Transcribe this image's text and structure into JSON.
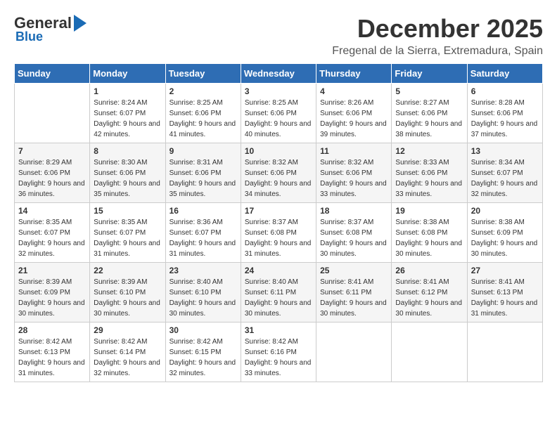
{
  "logo": {
    "general": "General",
    "blue": "Blue",
    "subtitle": "Blue"
  },
  "header": {
    "month_year": "December 2025",
    "location": "Fregenal de la Sierra, Extremadura, Spain"
  },
  "weekdays": [
    "Sunday",
    "Monday",
    "Tuesday",
    "Wednesday",
    "Thursday",
    "Friday",
    "Saturday"
  ],
  "weeks": [
    [
      {
        "day": "",
        "sunrise": "",
        "sunset": "",
        "daylight": ""
      },
      {
        "day": "1",
        "sunrise": "Sunrise: 8:24 AM",
        "sunset": "Sunset: 6:07 PM",
        "daylight": "Daylight: 9 hours and 42 minutes."
      },
      {
        "day": "2",
        "sunrise": "Sunrise: 8:25 AM",
        "sunset": "Sunset: 6:06 PM",
        "daylight": "Daylight: 9 hours and 41 minutes."
      },
      {
        "day": "3",
        "sunrise": "Sunrise: 8:25 AM",
        "sunset": "Sunset: 6:06 PM",
        "daylight": "Daylight: 9 hours and 40 minutes."
      },
      {
        "day": "4",
        "sunrise": "Sunrise: 8:26 AM",
        "sunset": "Sunset: 6:06 PM",
        "daylight": "Daylight: 9 hours and 39 minutes."
      },
      {
        "day": "5",
        "sunrise": "Sunrise: 8:27 AM",
        "sunset": "Sunset: 6:06 PM",
        "daylight": "Daylight: 9 hours and 38 minutes."
      },
      {
        "day": "6",
        "sunrise": "Sunrise: 8:28 AM",
        "sunset": "Sunset: 6:06 PM",
        "daylight": "Daylight: 9 hours and 37 minutes."
      }
    ],
    [
      {
        "day": "7",
        "sunrise": "Sunrise: 8:29 AM",
        "sunset": "Sunset: 6:06 PM",
        "daylight": "Daylight: 9 hours and 36 minutes."
      },
      {
        "day": "8",
        "sunrise": "Sunrise: 8:30 AM",
        "sunset": "Sunset: 6:06 PM",
        "daylight": "Daylight: 9 hours and 35 minutes."
      },
      {
        "day": "9",
        "sunrise": "Sunrise: 8:31 AM",
        "sunset": "Sunset: 6:06 PM",
        "daylight": "Daylight: 9 hours and 35 minutes."
      },
      {
        "day": "10",
        "sunrise": "Sunrise: 8:32 AM",
        "sunset": "Sunset: 6:06 PM",
        "daylight": "Daylight: 9 hours and 34 minutes."
      },
      {
        "day": "11",
        "sunrise": "Sunrise: 8:32 AM",
        "sunset": "Sunset: 6:06 PM",
        "daylight": "Daylight: 9 hours and 33 minutes."
      },
      {
        "day": "12",
        "sunrise": "Sunrise: 8:33 AM",
        "sunset": "Sunset: 6:06 PM",
        "daylight": "Daylight: 9 hours and 33 minutes."
      },
      {
        "day": "13",
        "sunrise": "Sunrise: 8:34 AM",
        "sunset": "Sunset: 6:07 PM",
        "daylight": "Daylight: 9 hours and 32 minutes."
      }
    ],
    [
      {
        "day": "14",
        "sunrise": "Sunrise: 8:35 AM",
        "sunset": "Sunset: 6:07 PM",
        "daylight": "Daylight: 9 hours and 32 minutes."
      },
      {
        "day": "15",
        "sunrise": "Sunrise: 8:35 AM",
        "sunset": "Sunset: 6:07 PM",
        "daylight": "Daylight: 9 hours and 31 minutes."
      },
      {
        "day": "16",
        "sunrise": "Sunrise: 8:36 AM",
        "sunset": "Sunset: 6:07 PM",
        "daylight": "Daylight: 9 hours and 31 minutes."
      },
      {
        "day": "17",
        "sunrise": "Sunrise: 8:37 AM",
        "sunset": "Sunset: 6:08 PM",
        "daylight": "Daylight: 9 hours and 31 minutes."
      },
      {
        "day": "18",
        "sunrise": "Sunrise: 8:37 AM",
        "sunset": "Sunset: 6:08 PM",
        "daylight": "Daylight: 9 hours and 30 minutes."
      },
      {
        "day": "19",
        "sunrise": "Sunrise: 8:38 AM",
        "sunset": "Sunset: 6:08 PM",
        "daylight": "Daylight: 9 hours and 30 minutes."
      },
      {
        "day": "20",
        "sunrise": "Sunrise: 8:38 AM",
        "sunset": "Sunset: 6:09 PM",
        "daylight": "Daylight: 9 hours and 30 minutes."
      }
    ],
    [
      {
        "day": "21",
        "sunrise": "Sunrise: 8:39 AM",
        "sunset": "Sunset: 6:09 PM",
        "daylight": "Daylight: 9 hours and 30 minutes."
      },
      {
        "day": "22",
        "sunrise": "Sunrise: 8:39 AM",
        "sunset": "Sunset: 6:10 PM",
        "daylight": "Daylight: 9 hours and 30 minutes."
      },
      {
        "day": "23",
        "sunrise": "Sunrise: 8:40 AM",
        "sunset": "Sunset: 6:10 PM",
        "daylight": "Daylight: 9 hours and 30 minutes."
      },
      {
        "day": "24",
        "sunrise": "Sunrise: 8:40 AM",
        "sunset": "Sunset: 6:11 PM",
        "daylight": "Daylight: 9 hours and 30 minutes."
      },
      {
        "day": "25",
        "sunrise": "Sunrise: 8:41 AM",
        "sunset": "Sunset: 6:11 PM",
        "daylight": "Daylight: 9 hours and 30 minutes."
      },
      {
        "day": "26",
        "sunrise": "Sunrise: 8:41 AM",
        "sunset": "Sunset: 6:12 PM",
        "daylight": "Daylight: 9 hours and 30 minutes."
      },
      {
        "day": "27",
        "sunrise": "Sunrise: 8:41 AM",
        "sunset": "Sunset: 6:13 PM",
        "daylight": "Daylight: 9 hours and 31 minutes."
      }
    ],
    [
      {
        "day": "28",
        "sunrise": "Sunrise: 8:42 AM",
        "sunset": "Sunset: 6:13 PM",
        "daylight": "Daylight: 9 hours and 31 minutes."
      },
      {
        "day": "29",
        "sunrise": "Sunrise: 8:42 AM",
        "sunset": "Sunset: 6:14 PM",
        "daylight": "Daylight: 9 hours and 32 minutes."
      },
      {
        "day": "30",
        "sunrise": "Sunrise: 8:42 AM",
        "sunset": "Sunset: 6:15 PM",
        "daylight": "Daylight: 9 hours and 32 minutes."
      },
      {
        "day": "31",
        "sunrise": "Sunrise: 8:42 AM",
        "sunset": "Sunset: 6:16 PM",
        "daylight": "Daylight: 9 hours and 33 minutes."
      },
      {
        "day": "",
        "sunrise": "",
        "sunset": "",
        "daylight": ""
      },
      {
        "day": "",
        "sunrise": "",
        "sunset": "",
        "daylight": ""
      },
      {
        "day": "",
        "sunrise": "",
        "sunset": "",
        "daylight": ""
      }
    ]
  ]
}
